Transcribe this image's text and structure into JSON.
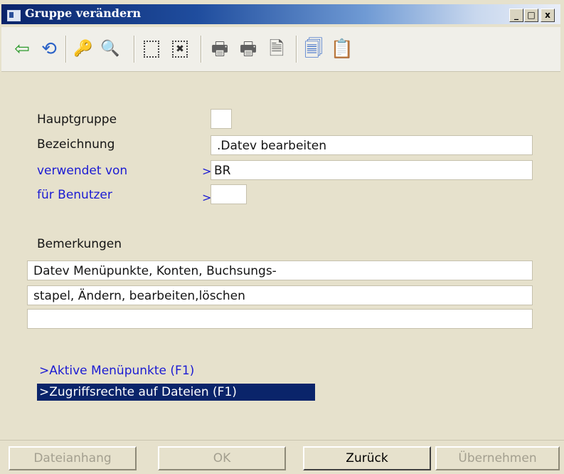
{
  "window": {
    "title": "Gruppe verändern",
    "minimize": "_",
    "maximize": "□",
    "close": "x"
  },
  "toolbar": {
    "back_icon": "⇦",
    "refresh_icon": "⟲",
    "key_icon": "🔑",
    "search_icon": "🔍",
    "select_icon": "",
    "deselect_icon": "✖",
    "print_icon": "🖶",
    "print_preview_icon": "🖶",
    "export_icon": "🗎",
    "copy_icon": "🗐",
    "paste_icon": "📋"
  },
  "form": {
    "hauptgruppe_label": "Hauptgruppe",
    "hauptgruppe_value": "",
    "bezeichnung_label": "Bezeichnung",
    "bezeichnung_value": ".Datev bearbeiten",
    "verwendet_von_label": "verwendet von",
    "verwendet_von_value": "BR",
    "fuer_benutzer_label": "für Benutzer",
    "fuer_benutzer_value": "",
    "lookup_marker": ">",
    "bemerkungen_label": "Bemerkungen",
    "bemerkungen_lines": [
      "Datev Menüpunkte, Konten, Buchsungs-",
      "stapel, Ändern, bearbeiten,löschen",
      ""
    ]
  },
  "links": {
    "aktive_menuepunkte": ">Aktive Menüpunkte (F1)",
    "zugriffsrechte": ">Zugriffsrechte auf Dateien (F1)"
  },
  "buttons": {
    "dateianhang": "Dateianhang",
    "ok": "OK",
    "zurueck": "Zurück",
    "uebernehmen": "Übernehmen"
  },
  "colors": {
    "label_blue": "#1b1bd3",
    "selection": "#0a246a",
    "panel": "#e6e1cc"
  }
}
